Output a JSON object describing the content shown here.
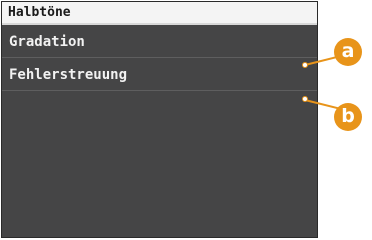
{
  "header": {
    "title": "Halbtöne"
  },
  "menu": {
    "items": [
      {
        "label": "Gradation"
      },
      {
        "label": "Fehlerstreuung"
      }
    ]
  },
  "callouts": [
    {
      "letter": "a"
    },
    {
      "letter": "b"
    }
  ],
  "colors": {
    "screen_background": "#454546",
    "header_background": "#f4f4f4",
    "callout_accent": "#e8941a"
  }
}
